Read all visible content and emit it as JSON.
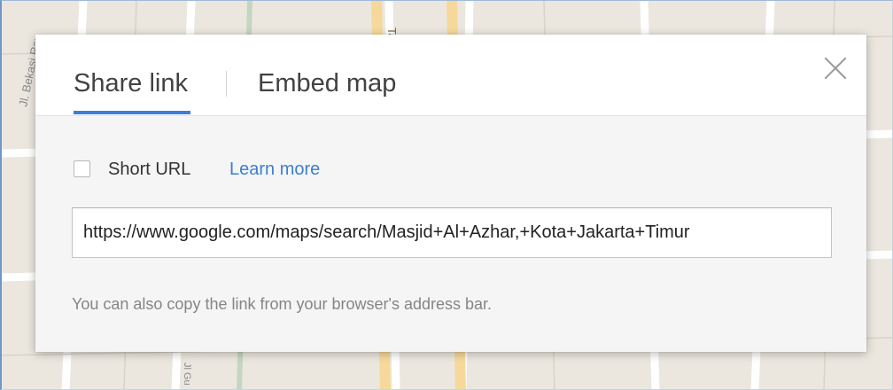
{
  "dialog": {
    "tabs": [
      {
        "label": "Share link",
        "active": true
      },
      {
        "label": "Embed map",
        "active": false
      }
    ],
    "close_icon": "close-icon",
    "short_url": {
      "label": "Short URL",
      "checked": false,
      "learn_more": "Learn more"
    },
    "url_field": {
      "value": "https://www.google.com/maps/search/Masjid+Al+Azhar,+Kota+Jakarta+Timur"
    },
    "hint": "You can also copy the link from your browser's address bar."
  },
  "map_labels": [
    "Jl. Bekasi Ray",
    "Ta",
    "Jl Gu"
  ],
  "colors": {
    "accent": "#3c7ddb",
    "link": "#3d7fd1",
    "dialog_bg": "#f5f5f5",
    "map_bg": "#ebe7df"
  }
}
